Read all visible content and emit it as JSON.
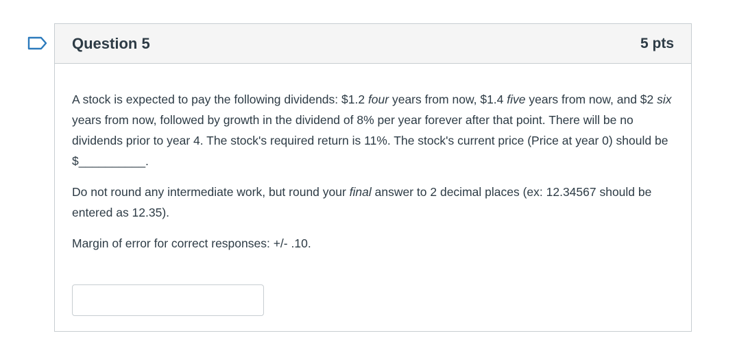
{
  "question": {
    "title": "Question 5",
    "points": "5 pts",
    "paragraph1": {
      "t1": "A stock is expected to pay the following dividends: $1.2 ",
      "i1": "four",
      "t2": " years from now, $1.4 ",
      "i2": "five",
      "t3": " years from now, and $2 ",
      "i3": "six",
      "t4": " years from now, followed by growth in the dividend of 8% per year forever after that point.  There will be no dividends prior to year 4.  The stock's required return is 11%. The stock's current price (Price at year 0) should be $__________."
    },
    "paragraph2": {
      "t1": "Do not round any intermediate work, but round your ",
      "i1": "final",
      "t2": " answer to 2 decimal places (ex: 12.34567 should be entered as 12.35)."
    },
    "paragraph3": "Margin of error for correct responses: +/- .10.",
    "answer_value": ""
  },
  "colors": {
    "flag_outline": "#2b7abc",
    "text": "#2d3b45",
    "border": "#c7cdd1",
    "header_bg": "#f5f5f5"
  },
  "icons": {
    "flag": "flag-question-icon"
  }
}
